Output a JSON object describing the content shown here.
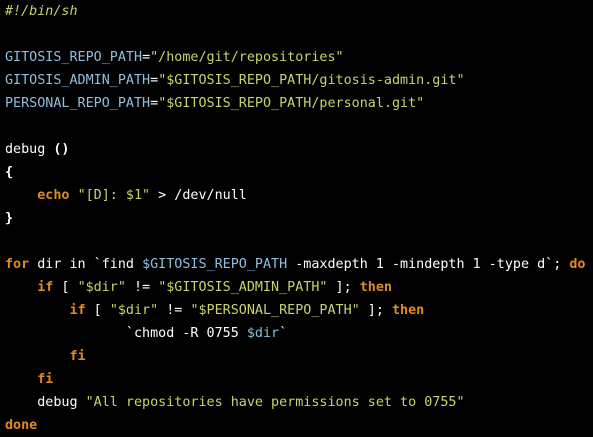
{
  "colors": {
    "background": "#000000",
    "plain_text": "#ffffff",
    "comment": "#c9d36a",
    "variable": "#8fbfdc",
    "string": "#c9d36a",
    "keyword": "#e28a20"
  },
  "code": {
    "lines": [
      [
        {
          "t": "comment",
          "v": "#!/bin/sh"
        }
      ],
      [],
      [
        {
          "t": "var",
          "v": "GITOSIS_REPO_PATH"
        },
        {
          "t": "plain",
          "v": "="
        },
        {
          "t": "str",
          "v": "\"/home/git/repositories\""
        }
      ],
      [
        {
          "t": "var",
          "v": "GITOSIS_ADMIN_PATH"
        },
        {
          "t": "plain",
          "v": "="
        },
        {
          "t": "str",
          "v": "\"$GITOSIS_REPO_PATH/gitosis-admin.git\""
        }
      ],
      [
        {
          "t": "var",
          "v": "PERSONAL_REPO_PATH"
        },
        {
          "t": "plain",
          "v": "="
        },
        {
          "t": "str",
          "v": "\"$GITOSIS_REPO_PATH/personal.git\""
        }
      ],
      [],
      [
        {
          "t": "plain",
          "v": "debug "
        },
        {
          "t": "paren",
          "v": "()"
        }
      ],
      [
        {
          "t": "paren",
          "v": "{"
        }
      ],
      [
        {
          "t": "plain",
          "v": "    "
        },
        {
          "t": "kw",
          "v": "echo"
        },
        {
          "t": "plain",
          "v": " "
        },
        {
          "t": "str",
          "v": "\"[D]: $1\""
        },
        {
          "t": "plain",
          "v": " > /dev/null"
        }
      ],
      [
        {
          "t": "paren",
          "v": "}"
        }
      ],
      [],
      [
        {
          "t": "kw",
          "v": "for"
        },
        {
          "t": "plain",
          "v": " dir in `find "
        },
        {
          "t": "var",
          "v": "$GITOSIS_REPO_PATH"
        },
        {
          "t": "plain",
          "v": " -maxdepth 1 -mindepth 1 -type d`; "
        },
        {
          "t": "kw",
          "v": "do"
        }
      ],
      [
        {
          "t": "plain",
          "v": "    "
        },
        {
          "t": "kw",
          "v": "if"
        },
        {
          "t": "plain",
          "v": " [ "
        },
        {
          "t": "str",
          "v": "\"$dir\""
        },
        {
          "t": "plain",
          "v": " != "
        },
        {
          "t": "str",
          "v": "\"$GITOSIS_ADMIN_PATH\""
        },
        {
          "t": "plain",
          "v": " ]; "
        },
        {
          "t": "kw",
          "v": "then"
        }
      ],
      [
        {
          "t": "plain",
          "v": "        "
        },
        {
          "t": "kw",
          "v": "if"
        },
        {
          "t": "plain",
          "v": " [ "
        },
        {
          "t": "str",
          "v": "\"$dir\""
        },
        {
          "t": "plain",
          "v": " != "
        },
        {
          "t": "str",
          "v": "\"$PERSONAL_REPO_PATH\""
        },
        {
          "t": "plain",
          "v": " ]; "
        },
        {
          "t": "kw",
          "v": "then"
        }
      ],
      [
        {
          "t": "plain",
          "v": "               `chmod -R 0755 "
        },
        {
          "t": "var",
          "v": "$dir"
        },
        {
          "t": "plain",
          "v": "`"
        }
      ],
      [
        {
          "t": "plain",
          "v": "        "
        },
        {
          "t": "kw",
          "v": "fi"
        }
      ],
      [
        {
          "t": "plain",
          "v": "    "
        },
        {
          "t": "kw",
          "v": "fi"
        }
      ],
      [
        {
          "t": "plain",
          "v": "    debug "
        },
        {
          "t": "str",
          "v": "\"All repositories have permissions set to 0755\""
        }
      ],
      [
        {
          "t": "kw",
          "v": "done"
        }
      ]
    ]
  }
}
